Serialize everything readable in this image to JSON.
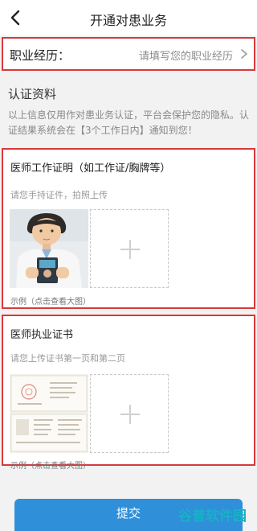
{
  "header": {
    "title": "开通对患业务"
  },
  "experience": {
    "label": "职业经历：",
    "placeholder": "请填写您的职业经历"
  },
  "certification": {
    "title": "认证资料",
    "description": "以上信息仅用作对患业务认证，平台会保护您的隐私。认证结果系统会在【3个工作日内】通知到您！"
  },
  "cards": [
    {
      "title": "医师工作证明（如工作证/胸牌等）",
      "hint": "请您手持证件，拍照上传",
      "example": "示例（点击查看大图）"
    },
    {
      "title": "医师执业证书",
      "hint": "请您上传证书第一页和第二页",
      "example": "示例（点击查看大图）"
    }
  ],
  "submit": {
    "label": "提交"
  },
  "watermark": {
    "text": "谷普软件园"
  },
  "colors": {
    "highlight": "#d9383a",
    "primary": "#2f8fd8",
    "watermark": "#1ab0c8"
  }
}
